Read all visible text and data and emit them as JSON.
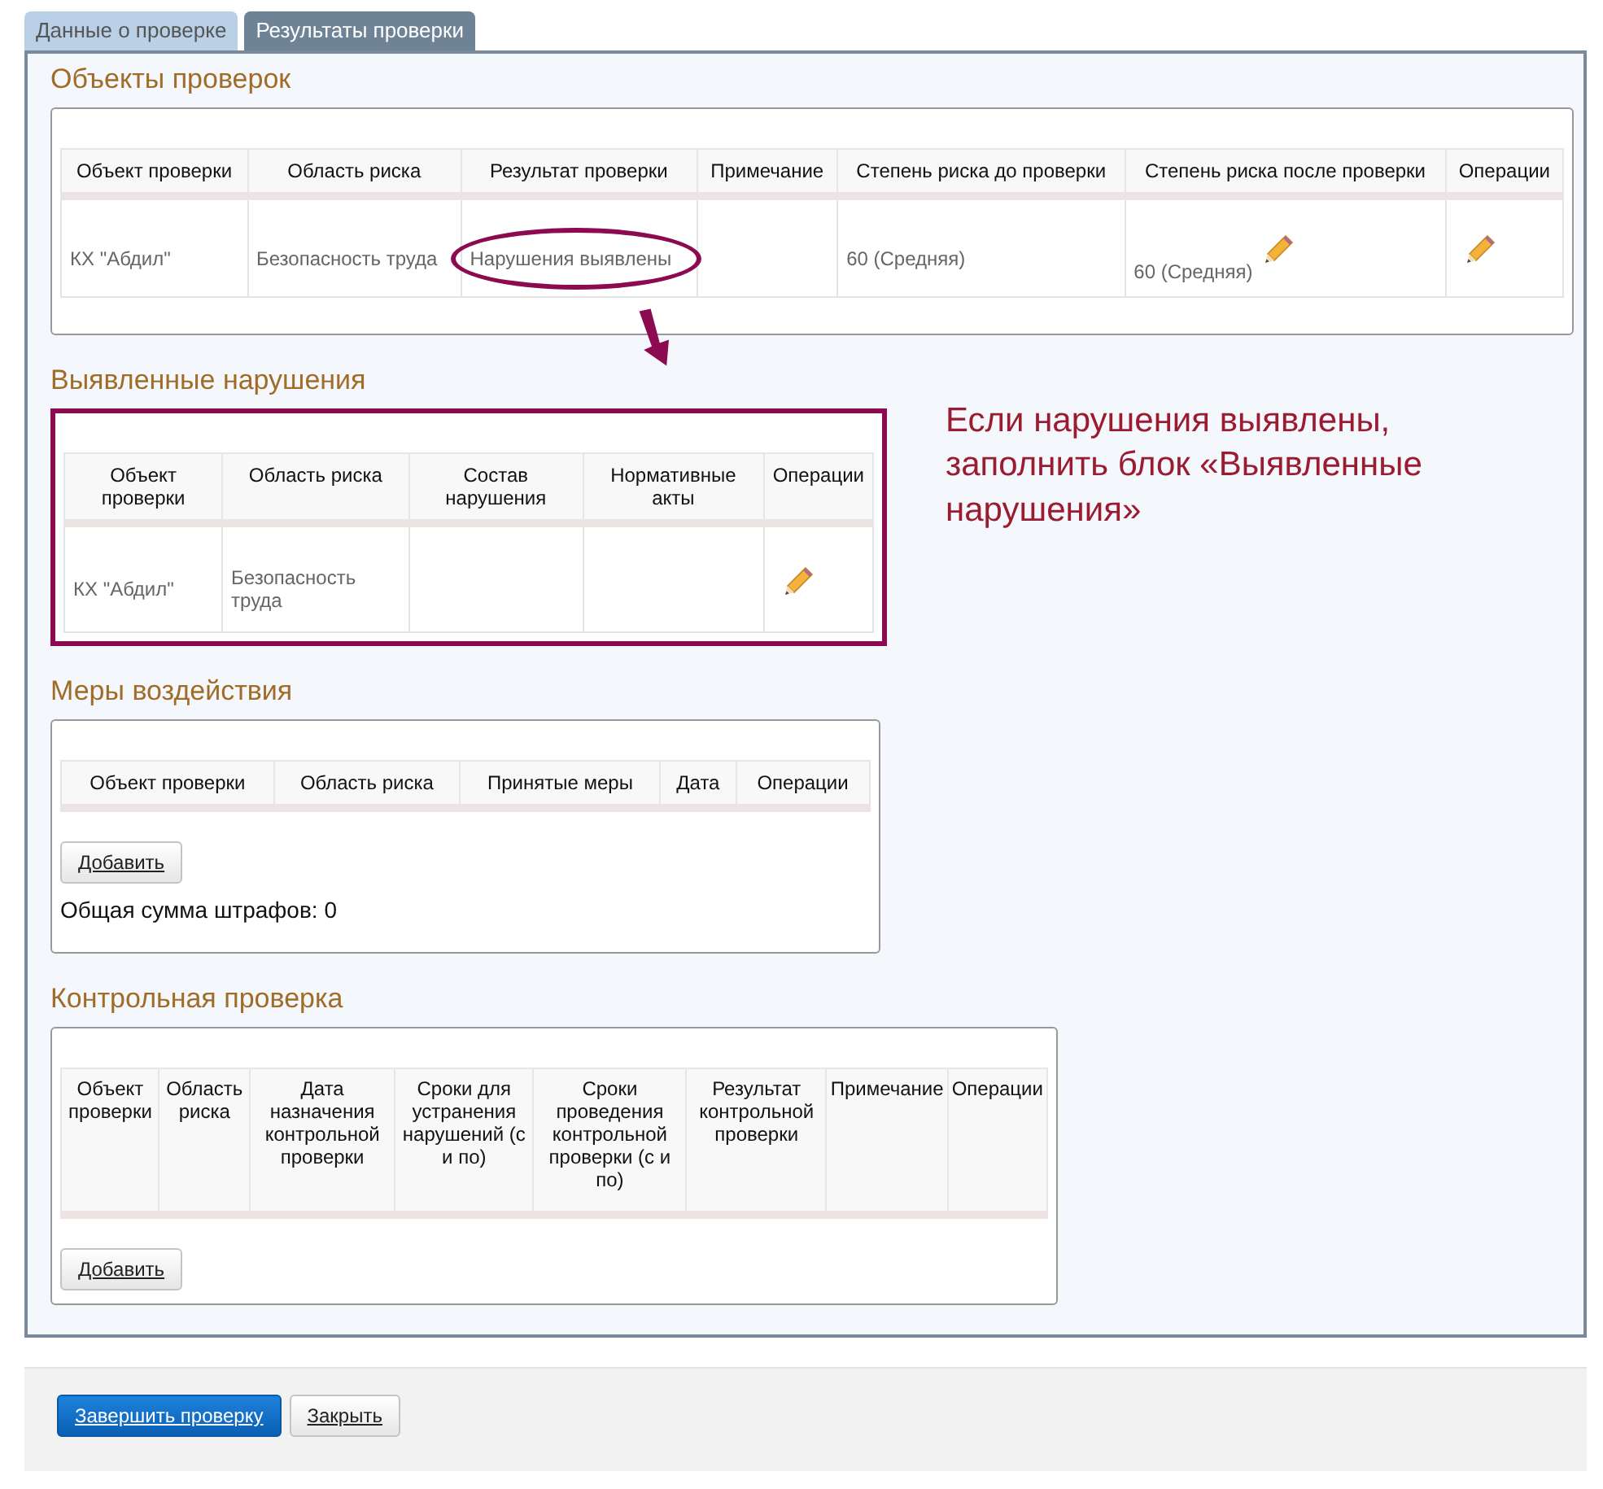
{
  "tabs": [
    {
      "label": "Данные о проверке",
      "selected": false
    },
    {
      "label": "Результаты проверки",
      "selected": true
    }
  ],
  "sections": [
    {
      "title": "Объекты проверок",
      "highlighted": false,
      "columns": [
        "Объект проверки",
        "Область риска",
        "Результат проверки",
        "Примечание",
        "Степень риска до проверки",
        "Степень риска после проверки",
        "Операции"
      ],
      "rows": [
        [
          {
            "text": "КХ \"Абдил\""
          },
          {
            "text": "Безопасность труда"
          },
          {
            "text": "Нарушения выявлены",
            "circled": true
          },
          {},
          {
            "text": "60 (Средняя)"
          },
          {
            "text": "60 (Средняя)",
            "edit": true
          },
          {
            "edit": true
          }
        ]
      ]
    },
    {
      "title": "Выявленные нарушения",
      "highlighted": true,
      "columns": [
        "Объект проверки",
        "Область риска",
        "Состав нарушения",
        "Нормативные акты",
        "Операции"
      ],
      "rows": [
        [
          {
            "text": "КХ \"Абдил\""
          },
          {
            "text": "Безопасность труда"
          },
          {},
          {},
          {
            "edit": true
          }
        ]
      ]
    },
    {
      "title": "Меры воздействия",
      "highlighted": false,
      "columns": [
        "Объект проверки",
        "Область риска",
        "Принятые меры",
        "Дата",
        "Операции"
      ],
      "button": "Добавить",
      "total": "Общая сумма штрафов: 0"
    },
    {
      "title": "Контрольная проверка",
      "highlighted": false,
      "columns": [
        "Объект проверки",
        "Область риска",
        "Дата назначения контрольной проверки",
        "Сроки для устранения нарушений (с и по)",
        "Сроки проведения контрольной проверки (с и по)",
        "Результат контрольной проверки",
        "Примечание",
        "Операции"
      ],
      "button": "Добавить"
    }
  ],
  "annotation": {
    "text": "Если нарушения выявлены, заполнить блок «Выявленные нарушения»"
  },
  "footer": {
    "buttons": [
      {
        "label": "Завершить проверку",
        "kind": "primary"
      },
      {
        "label": "Закрыть",
        "kind": "default"
      }
    ]
  }
}
